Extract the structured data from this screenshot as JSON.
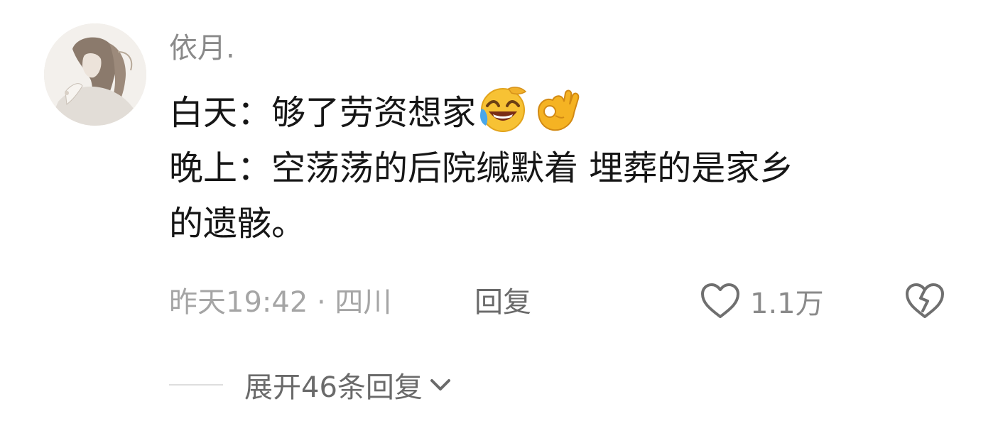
{
  "comment": {
    "username": "依月.",
    "lines": [
      "白天：够了劳资想家",
      "晚上：空荡荡的后院缄默着 埋葬的是家乡",
      "的遗骸。"
    ],
    "emojis": [
      "laughing-crying-emoji",
      "ok-hand-emoji"
    ],
    "meta": "昨天19:42 · 四川",
    "reply_label": "回复",
    "like_count": "1.1万",
    "expand_label": "展开46条回复"
  },
  "icons": {
    "like": "heart-outline-icon",
    "dislike": "broken-heart-icon",
    "expand": "chevron-down-icon"
  },
  "colors": {
    "text": "#161616",
    "muted": "#8a8a8a",
    "meta": "#a5a5a5",
    "emoji_yellow": "#f7c234"
  }
}
